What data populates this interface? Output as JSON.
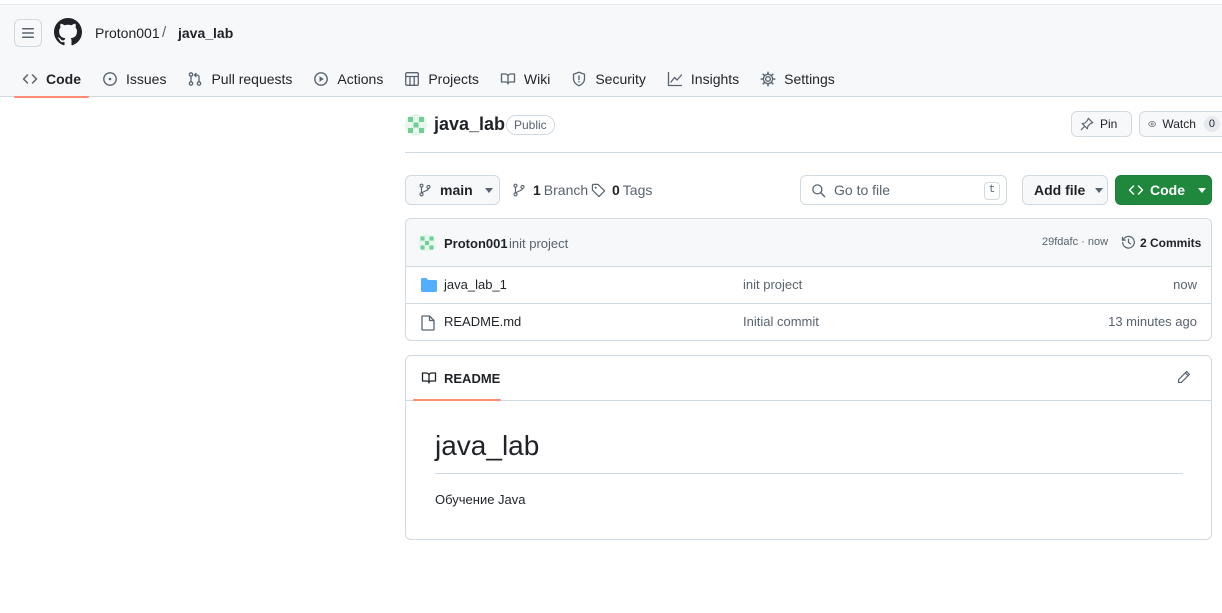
{
  "header": {
    "owner": "Proton001",
    "separator": "/",
    "repo": "java_lab"
  },
  "tabs": [
    {
      "label": "Code",
      "icon": "code-icon",
      "active": true
    },
    {
      "label": "Issues",
      "icon": "issue-icon"
    },
    {
      "label": "Pull requests",
      "icon": "pull-request-icon"
    },
    {
      "label": "Actions",
      "icon": "play-icon"
    },
    {
      "label": "Projects",
      "icon": "table-icon"
    },
    {
      "label": "Wiki",
      "icon": "book-icon"
    },
    {
      "label": "Security",
      "icon": "shield-icon"
    },
    {
      "label": "Insights",
      "icon": "graph-icon"
    },
    {
      "label": "Settings",
      "icon": "gear-icon"
    }
  ],
  "repo": {
    "name": "java_lab",
    "visibility": "Public",
    "pin_label": "Pin",
    "watch_label": "Watch",
    "watch_count": "0"
  },
  "branch": {
    "current": "main",
    "branch_count": "1",
    "branch_label": "Branch",
    "tag_count": "0",
    "tag_label": "Tags"
  },
  "search": {
    "placeholder": "Go to file",
    "shortcut": "t"
  },
  "actions": {
    "add_file": "Add file",
    "code": "Code"
  },
  "latest_commit": {
    "author": "Proton001",
    "message": "init project",
    "meta": "29fdafc · now",
    "commits_label": "2 Commits"
  },
  "files": [
    {
      "name": "java_lab_1",
      "type": "folder",
      "commit": "init project",
      "time": "now"
    },
    {
      "name": "README.md",
      "type": "file",
      "commit": "Initial commit",
      "time": "13 minutes ago"
    }
  ],
  "readme": {
    "tab_label": "README",
    "heading": "java_lab",
    "body": "Обучение Java"
  },
  "colors": {
    "accent_underline": "#fd8c73",
    "primary_button": "#1f883d",
    "folder": "#54aeff",
    "avatar": "#6fcf97"
  }
}
